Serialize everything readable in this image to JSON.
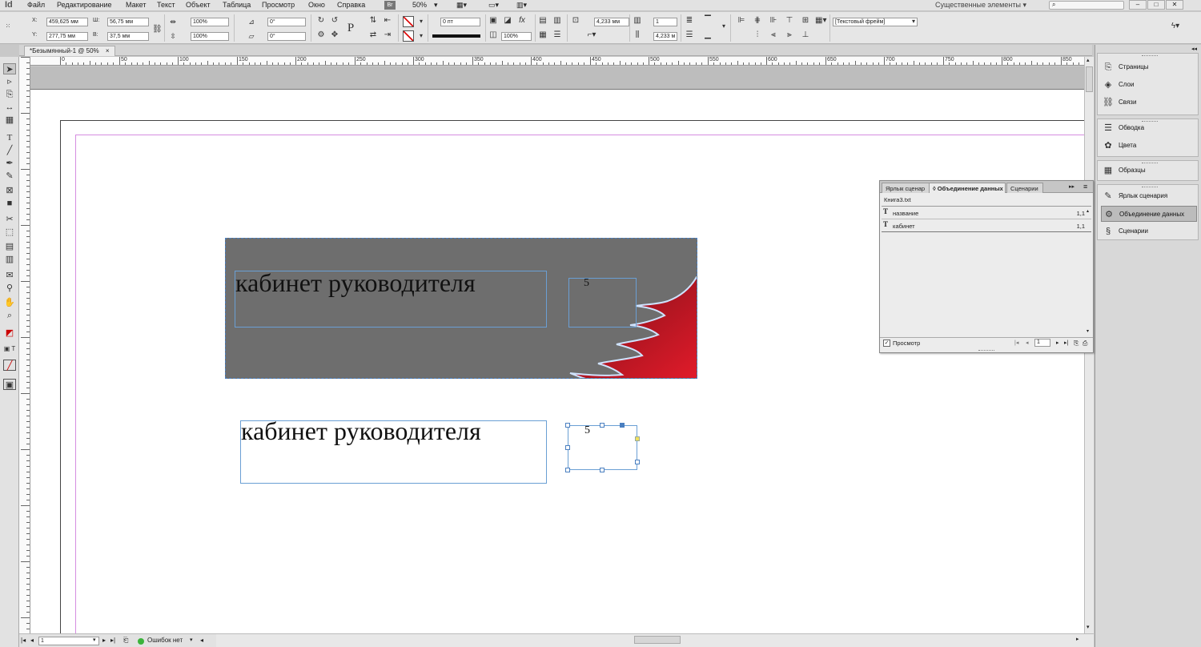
{
  "app": {
    "logo": "Id",
    "zoom": "50%",
    "workspace": "Существенные элементы",
    "workspace_arrow": "▾",
    "bridge": "Br"
  },
  "menu": [
    "Файл",
    "Редактирование",
    "Макет",
    "Текст",
    "Объект",
    "Таблица",
    "Просмотр",
    "Окно",
    "Справка"
  ],
  "window_buttons": [
    "–",
    "□",
    "✕"
  ],
  "control": {
    "x_label": "X:",
    "x_value": "459,625 мм",
    "y_label": "Y:",
    "y_value": "277,75 мм",
    "w_label": "Ш:",
    "w_value": "56,75 мм",
    "h_label": "В:",
    "h_value": "37,5 мм",
    "scale_x": "100%",
    "scale_y": "100%",
    "rotate": "0°",
    "shear": "0°",
    "stroke_weight": "0 пт",
    "opacity": "100%",
    "inset": "4,233 мм",
    "columns": "1",
    "gutter": "4,233 м",
    "frame_style": "[Текстовый фрейм]"
  },
  "doc_tab": {
    "title": "*Безымянный-1 @ 50%",
    "close": "×"
  },
  "ruler_labels": [
    "0",
    "50",
    "100",
    "150",
    "200",
    "250",
    "300",
    "350",
    "400",
    "450",
    "500",
    "550",
    "600",
    "650",
    "700",
    "750",
    "800",
    "850"
  ],
  "canvas": {
    "banner_title": "кабинет руководителя",
    "banner_number": "5",
    "plain_title": "кабинет руководителя",
    "plain_number": "5"
  },
  "status": {
    "page": "1",
    "errors": "Ошибок нет"
  },
  "dock": {
    "group1": [
      "Страницы",
      "Слои",
      "Связи"
    ],
    "group2": [
      "Обводка",
      "Цвета"
    ],
    "group3": [
      "Образцы"
    ],
    "group4": [
      "Ярлык сценария",
      "Объединение данных",
      "Сценарии"
    ]
  },
  "data_merge": {
    "tabs": [
      "Ярлык сценар",
      "◊ Объединение данных",
      "Сценарии"
    ],
    "tab_controls": "▸▸",
    "menu_icon": "≡",
    "source": "Книга3.txt",
    "fields": [
      {
        "name": "название",
        "page": "1,1"
      },
      {
        "name": "кабинет",
        "page": "1,1"
      }
    ],
    "field_icon": "T",
    "preview_label": "Просмотр",
    "preview_checked": "✓",
    "record": "1"
  },
  "colors": {
    "banner_gray": "#6e6e6e",
    "accent_red": "#e21b2a",
    "frame_blue": "#6a9fd4",
    "margin_guide": "#d58de0"
  }
}
